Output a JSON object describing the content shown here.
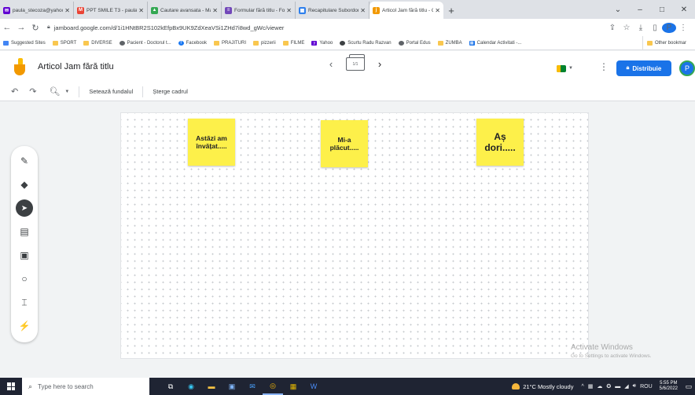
{
  "browser": {
    "tabs": [
      {
        "title": "paula_stecoza@yahoo.com",
        "icon": "yahoo-mail-icon",
        "color": "#6001d2",
        "active": false
      },
      {
        "title": "PPT SMILE T3 - paularamon",
        "icon": "gmail-icon",
        "color": "#ea4335",
        "active": false
      },
      {
        "title": "Cautare avansata - Materia",
        "icon": "drive-icon",
        "color": "#34a853",
        "active": false
      },
      {
        "title": "Formular fără titlu - Formul",
        "icon": "forms-icon",
        "color": "#7248b9",
        "active": false
      },
      {
        "title": "Recapitulare Subordonatel",
        "icon": "wordwall-icon",
        "color": "#2f80ed",
        "active": false
      },
      {
        "title": "Articol Jam fără titlu - Goo",
        "icon": "jamboard-icon",
        "color": "#f29900",
        "active": true
      }
    ],
    "new_tab": "+",
    "window_controls": {
      "minimize": "–",
      "maximize": "□",
      "close": "✕"
    },
    "url": "jamboard.google.com/d/1i1HNtBR2S102kEfpBx9UK9ZdXeaVSi1ZHd7i8wd_gWc/viewer",
    "profile_initial": "P",
    "bookmarks": [
      {
        "label": "Suggested Sites",
        "type": "site",
        "color": "#4285f4"
      },
      {
        "label": "SPORT",
        "type": "folder"
      },
      {
        "label": "DIVERSE",
        "type": "folder"
      },
      {
        "label": "Pacient - Doctorul t...",
        "type": "site",
        "color": "#5f6368"
      },
      {
        "label": "Facebook",
        "type": "site",
        "color": "#1877f2"
      },
      {
        "label": "PRAJITURI",
        "type": "folder"
      },
      {
        "label": "pizzerii",
        "type": "folder"
      },
      {
        "label": "FILME",
        "type": "folder"
      },
      {
        "label": "Yahoo",
        "type": "site",
        "color": "#6001d2"
      },
      {
        "label": "Scurtu Radu Razvan",
        "type": "site",
        "color": "#3c4043"
      },
      {
        "label": "Portal Edus",
        "type": "site",
        "color": "#5f6368"
      },
      {
        "label": "ZUMBA",
        "type": "folder"
      },
      {
        "label": "Calendar Activitati -...",
        "type": "site",
        "color": "#1a73e8"
      }
    ],
    "other_bookmarks": "Other bookmar"
  },
  "app": {
    "title": "Articol Jam fără titlu",
    "frame_counter": "1/1",
    "share_label": "Distribuie",
    "account_initial": "P",
    "toolbar": {
      "set_background": "Setează fundalul",
      "clear_frame": "Șterge cadrul"
    },
    "tools": [
      {
        "name": "pen-tool",
        "glyph": "✎"
      },
      {
        "name": "eraser-tool",
        "glyph": "◆"
      },
      {
        "name": "select-tool",
        "glyph": "➤"
      },
      {
        "name": "sticky-note-tool",
        "glyph": "▤"
      },
      {
        "name": "add-image-tool",
        "glyph": "▣"
      },
      {
        "name": "circle-tool",
        "glyph": "○"
      },
      {
        "name": "text-box-tool",
        "glyph": "⌶"
      },
      {
        "name": "laser-tool",
        "glyph": "⚡"
      }
    ],
    "notes": [
      {
        "text": "Astăzi am învățat.....",
        "color": "#fdf04a"
      },
      {
        "text": "Mi-a plăcut.....",
        "color": "#fdf04a"
      },
      {
        "text": "Aș dori.....",
        "color": "#fdf04a"
      }
    ]
  },
  "watermark": {
    "line1": "Activate Windows",
    "line2": "Go to Settings to activate Windows."
  },
  "taskbar": {
    "search_placeholder": "Type here to search",
    "weather": "21°C  Mostly cloudy",
    "lang": "ROU",
    "time": "5:55 PM",
    "date": "5/6/2022"
  }
}
